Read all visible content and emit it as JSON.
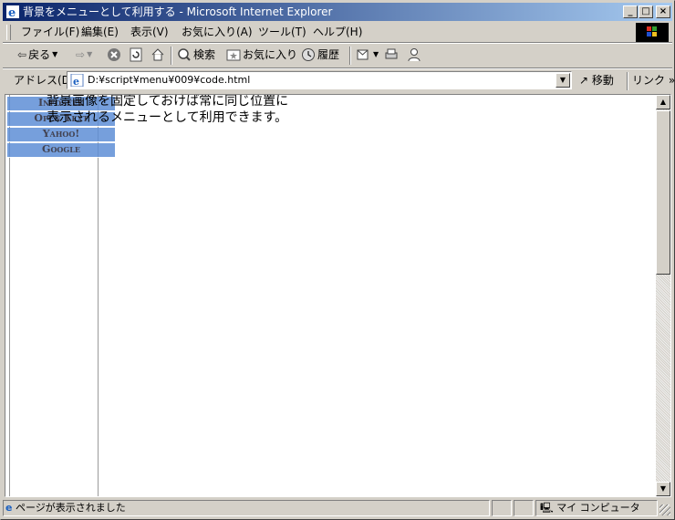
{
  "window": {
    "title": "背景をメニューとして利用する - Microsoft Internet Explorer",
    "minimize": "_",
    "maximize": "□",
    "close": "×"
  },
  "menu": {
    "items": [
      {
        "label": "ファイル(F)"
      },
      {
        "label": "編集(E)"
      },
      {
        "label": "表示(V)"
      },
      {
        "label": "お気に入り(A)"
      },
      {
        "label": "ツール(T)"
      },
      {
        "label": "ヘルプ(H)"
      }
    ]
  },
  "toolbar": {
    "back_label": "戻る",
    "search_label": "検索",
    "favorites_label": "お気に入り",
    "history_label": "履歴"
  },
  "address": {
    "label": "アドレス(D)",
    "url": "D:¥script¥menu¥009¥code.html",
    "go_label": "移動",
    "links_label": "リンク »"
  },
  "page": {
    "side_menu": [
      "Infoseek",
      "Open Text",
      "Yahoo!",
      "Google"
    ],
    "text_line1": "背景画像を固定しておけば常に同じ位置に",
    "text_line2": "表示されるメニューとして利用できます。"
  },
  "status": {
    "message": "ページが表示されました",
    "zone": "マイ コンピュータ"
  }
}
